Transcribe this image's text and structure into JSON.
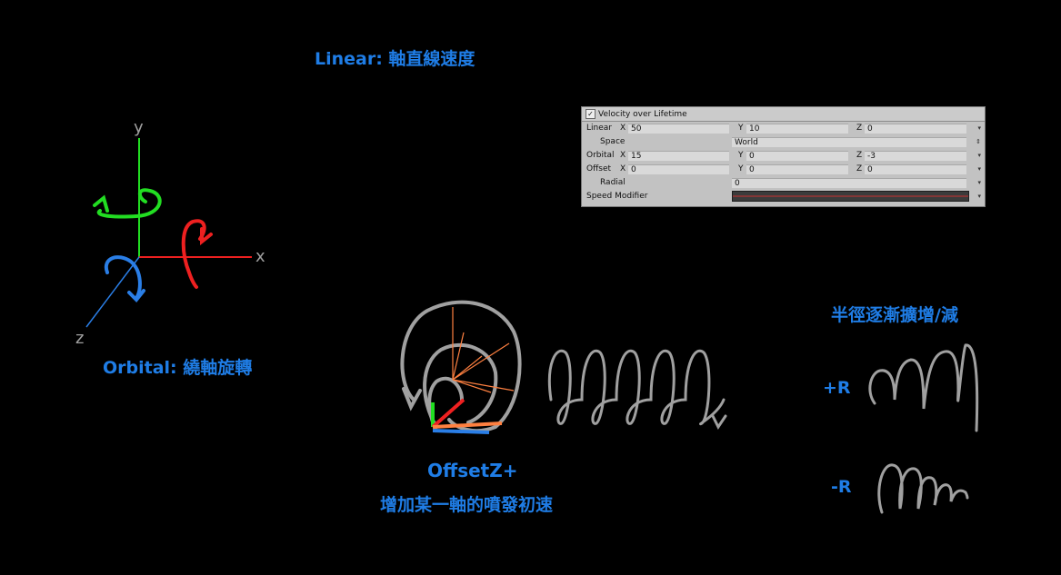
{
  "titles": {
    "linear": "Linear: 軸直線速度",
    "orbital": "Orbital: 繞軸旋轉",
    "offset_line1": "OffsetZ+",
    "offset_line2": "增加某一軸的噴發初速",
    "radial": "半徑逐漸擴增/減",
    "plus_r": "+R",
    "minus_r": "-R"
  },
  "axes": {
    "x": "x",
    "y": "y",
    "z": "z"
  },
  "panel": {
    "title": "Velocity over Lifetime",
    "checked": "✓",
    "rows": [
      {
        "label": "Linear",
        "x_prefix": "X",
        "x": "50",
        "y_prefix": "Y",
        "y": "10",
        "z_prefix": "Z",
        "z": "0"
      },
      {
        "label": "Space",
        "value": "World"
      },
      {
        "label": "Orbital",
        "x_prefix": "X",
        "x": "15",
        "y_prefix": "Y",
        "y": "0",
        "z_prefix": "Z",
        "z": "-3"
      },
      {
        "label": "Offset",
        "x_prefix": "X",
        "x": "0",
        "y_prefix": "Y",
        "y": "0",
        "z_prefix": "Z",
        "z": "0"
      },
      {
        "label": "Radial",
        "value": "0"
      },
      {
        "label": "Speed Modifier"
      }
    ]
  },
  "colors": {
    "accent_blue": "#1f7de6",
    "axis_green": "#22dd22",
    "axis_red": "#ee2020",
    "axis_blue": "#2a7ee6",
    "sketch_gray": "#a0a0a0",
    "arrow_orange": "#ff8040"
  }
}
